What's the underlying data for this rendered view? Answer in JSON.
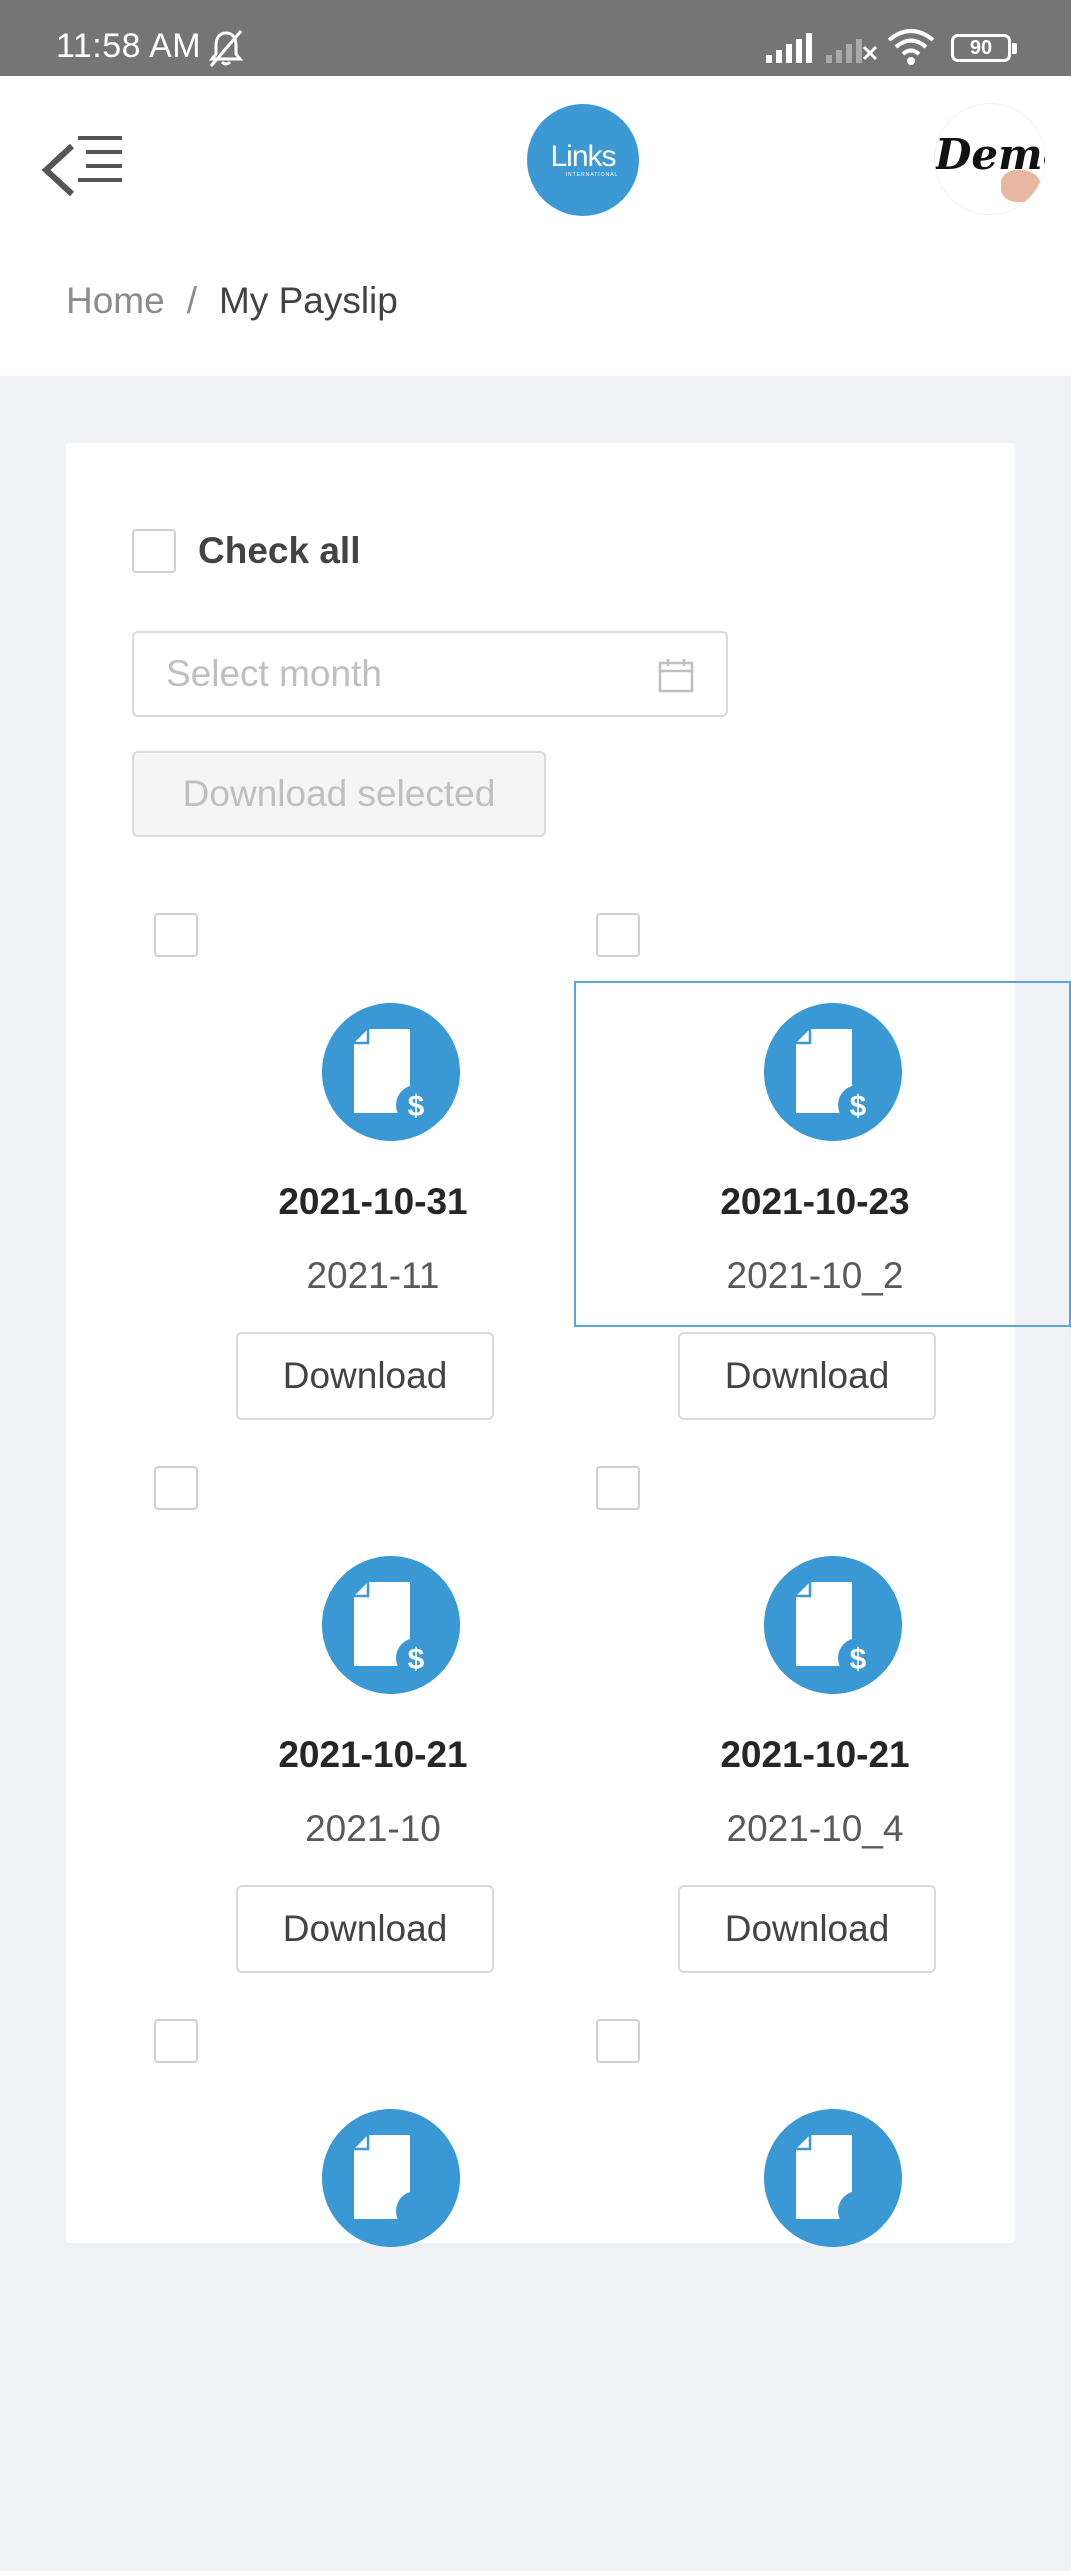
{
  "status_bar": {
    "time": "11:58 AM",
    "battery": "90"
  },
  "header": {
    "logo_text": "Links",
    "logo_subtext": "INTERNATIONAL",
    "avatar_text": "Demo"
  },
  "breadcrumb": {
    "home": "Home",
    "separator": "/",
    "current": "My Payslip"
  },
  "controls": {
    "check_all_label": "Check all",
    "month_placeholder": "Select month",
    "download_selected_label": "Download selected"
  },
  "payslips": [
    {
      "date": "2021-10-31",
      "period": "2021-11",
      "download_label": "Download"
    },
    {
      "date": "2021-10-23",
      "period": "2021-10_2",
      "download_label": "Download"
    },
    {
      "date": "2021-10-21",
      "period": "2021-10",
      "download_label": "Download"
    },
    {
      "date": "2021-10-21",
      "period": "2021-10_4",
      "download_label": "Download"
    },
    {
      "date": "",
      "period": "",
      "download_label": ""
    },
    {
      "date": "",
      "period": "",
      "download_label": ""
    }
  ],
  "colors": {
    "accent": "#3a98d4",
    "status_bar": "#757575",
    "page_background": "#eff1f5"
  }
}
